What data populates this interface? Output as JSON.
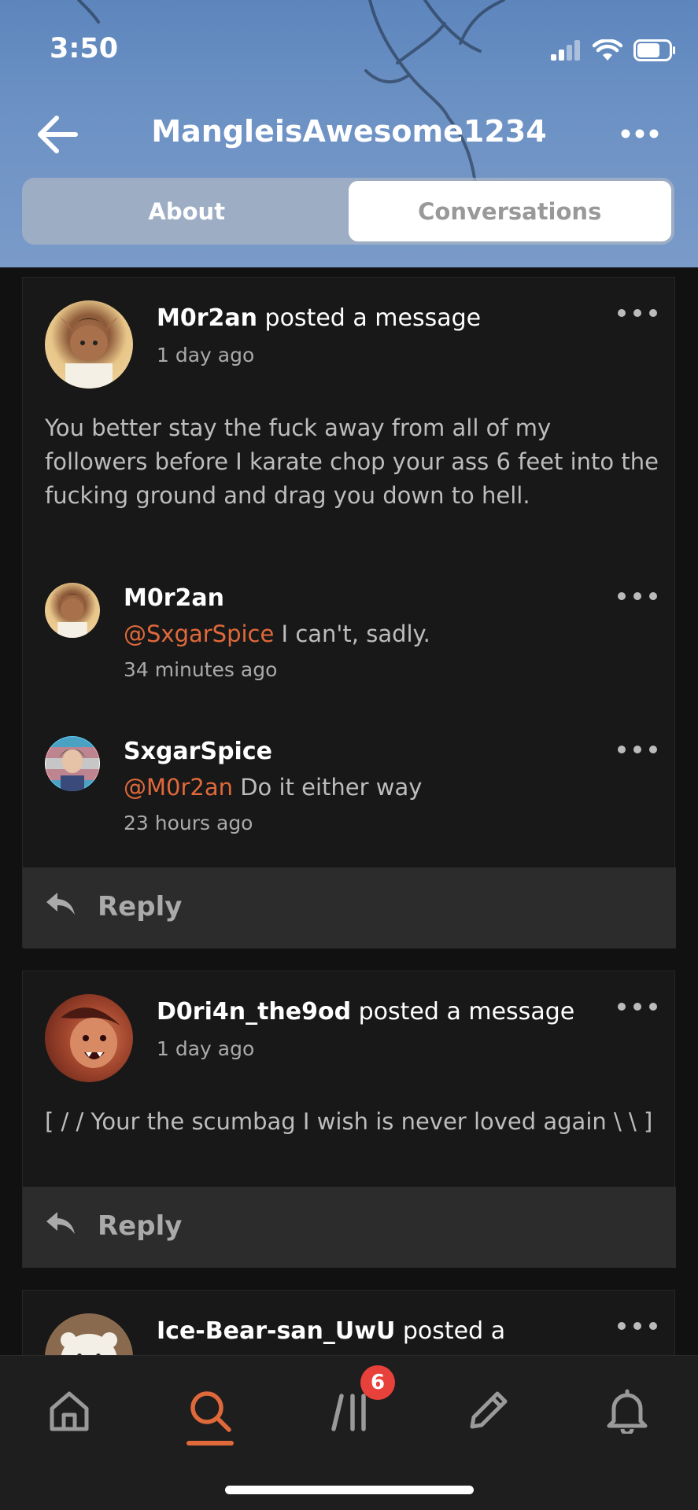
{
  "status_bar": {
    "time": "3:50"
  },
  "header": {
    "title": "MangleisAwesome1234",
    "tabs": [
      {
        "label": "About",
        "selected": false
      },
      {
        "label": "Conversations",
        "selected": true
      }
    ]
  },
  "posts": [
    {
      "author": "M0r2an",
      "action": " posted a message",
      "time": "1 day ago",
      "body": "You better stay the fuck away from all of my followers before I karate chop your ass 6 feet into the fucking ground and drag you down to hell.",
      "comments": [
        {
          "author": "M0r2an",
          "mention": "@SxgarSpice",
          "text": " I can't, sadly.",
          "time": "34 minutes ago"
        },
        {
          "author": "SxgarSpice",
          "mention": "@M0r2an",
          "text": " Do it either way",
          "time": "23 hours ago"
        }
      ],
      "reply_label": "Reply"
    },
    {
      "author": "D0ri4n_the9od",
      "action": " posted a message",
      "time": "1 day ago",
      "body": "[ / / Your the scumbag I wish is never loved again \\ \\ ]",
      "reply_label": "Reply"
    },
    {
      "author": "Ice-Bear-san_UwU",
      "action": " posted a"
    }
  ],
  "tabbar": {
    "items": [
      "home-icon",
      "search-icon",
      "chats-icon",
      "pencil-icon",
      "bell-icon"
    ],
    "active": "search-icon",
    "badge_count": "6"
  },
  "colors": {
    "accent": "#e0693b",
    "badge": "#e8413b"
  }
}
